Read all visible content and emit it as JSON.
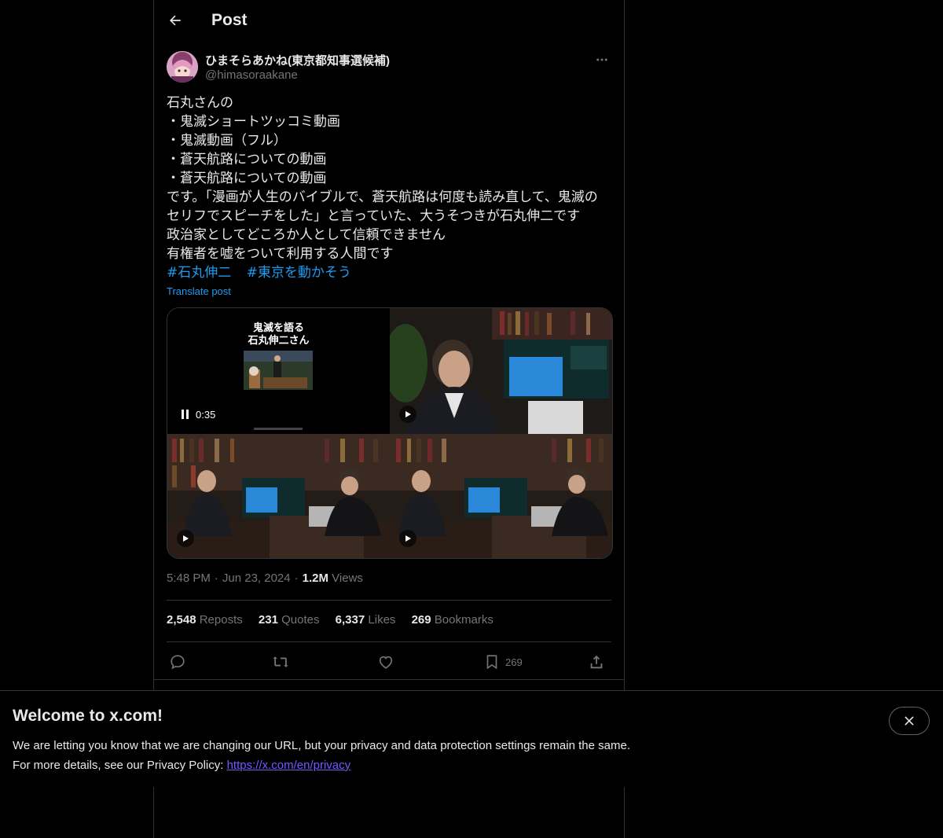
{
  "header": {
    "title": "Post"
  },
  "author": {
    "name": "ひまそらあかね(東京都知事選候補)",
    "handle": "@himasoraakane"
  },
  "post": {
    "lines": [
      "石丸さんの",
      "・鬼滅ショートツッコミ動画",
      "・鬼滅動画（フル）",
      "・蒼天航路についての動画",
      "・蒼天航路についての動画",
      "です。「漫画が人生のバイブルで、蒼天航路は何度も読み直して、鬼滅の",
      "セリフでスピーチをした」と言っていた、大うそつきが石丸伸二です",
      "政治家としてどころか人として信頼できません",
      "有権者を嘘をついて利用する人間です"
    ],
    "hashtags": [
      "#石丸伸二",
      "#東京を動かそう"
    ],
    "translate_label": "Translate post"
  },
  "media": {
    "video1": {
      "title_line1": "鬼滅を語る",
      "title_line2": "石丸伸二さん",
      "duration": "0:35"
    }
  },
  "meta": {
    "time": "5:48 PM",
    "date": "Jun 23, 2024",
    "views_num": "1.2M",
    "views_label": "Views"
  },
  "stats": {
    "reposts_num": "2,548",
    "reposts_label": "Reposts",
    "quotes_num": "231",
    "quotes_label": "Quotes",
    "likes_num": "6,337",
    "likes_label": "Likes",
    "bookmarks_num": "269",
    "bookmarks_label": "Bookmarks"
  },
  "actions": {
    "bookmark_count": "269"
  },
  "icons": [
    "back-arrow-icon",
    "more-icon",
    "reply-icon",
    "repost-icon",
    "like-icon",
    "bookmark-icon",
    "share-icon",
    "play-icon",
    "pause-icon",
    "close-icon"
  ],
  "banner": {
    "title": "Welcome to x.com!",
    "line1": "We are letting you know that we are changing our URL, but your privacy and data protection settings remain the same.",
    "line2_prefix": "For more details, see our Privacy Policy: ",
    "link": "https://x.com/en/privacy"
  },
  "colors": {
    "accent": "#1d9bf0",
    "background": "#000000",
    "text": "#e7e9ea",
    "muted": "#71767b",
    "border": "#2f3336",
    "link": "#7856ff"
  }
}
